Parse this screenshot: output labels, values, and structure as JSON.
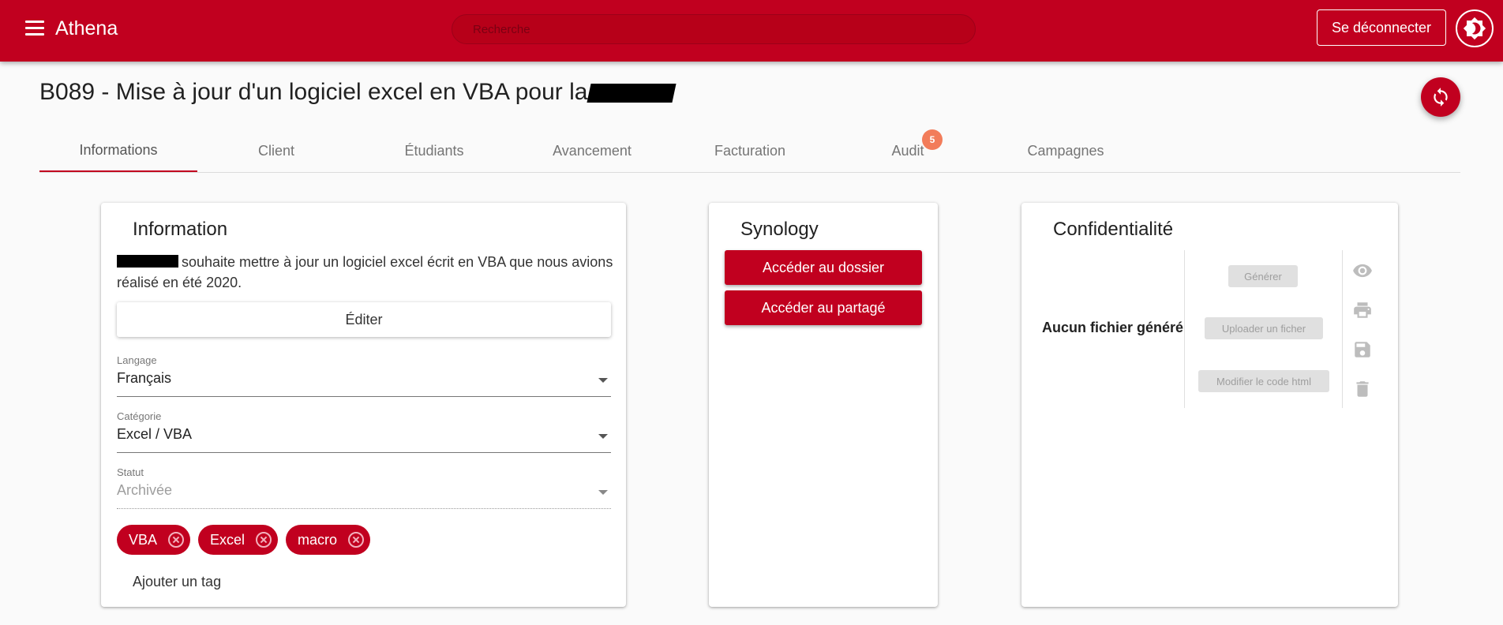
{
  "app": {
    "title": "Athena",
    "search_placeholder": "Recherche",
    "logout_label": "Se déconnecter",
    "accent_color": "#c1001f"
  },
  "page": {
    "title": "B089 - Mise à jour d'un logiciel excel en VBA pour la"
  },
  "tabs": [
    {
      "label": "Informations",
      "active": true
    },
    {
      "label": "Client"
    },
    {
      "label": "Étudiants"
    },
    {
      "label": "Avancement"
    },
    {
      "label": "Facturation"
    },
    {
      "label": "Audit",
      "badge": "5"
    },
    {
      "label": "Campagnes"
    }
  ],
  "information": {
    "title": "Information",
    "description": "souhaite mettre à jour un logiciel excel écrit en VBA que nous avions réalisé en été 2020.",
    "edit_label": "Éditer",
    "fields": [
      {
        "label": "Langage",
        "value": "Français"
      },
      {
        "label": "Catégorie",
        "value": "Excel / VBA"
      },
      {
        "label": "Statut",
        "value": "Archivée",
        "disabled": true
      }
    ],
    "tags": [
      "VBA",
      "Excel",
      "macro"
    ],
    "add_tag_placeholder": "Ajouter un tag"
  },
  "synology": {
    "title": "Synology",
    "buttons": [
      "Accéder au dossier",
      "Accéder au partagé"
    ]
  },
  "confidentiality": {
    "title": "Confidentialité",
    "empty_label": "Aucun fichier généré",
    "buttons": [
      "Générer",
      "Uploader un ficher",
      "Modifier le code html"
    ],
    "icons": [
      "eye-icon",
      "print-icon",
      "save-icon",
      "delete-icon"
    ]
  }
}
